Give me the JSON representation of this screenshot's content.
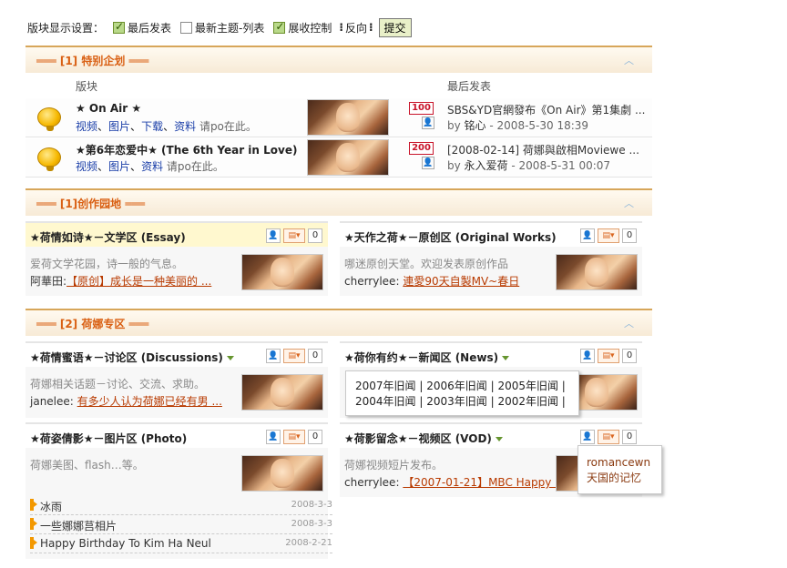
{
  "topbar": {
    "label": "版块显示设置：",
    "options": [
      {
        "label": "最后发表",
        "checked": true
      },
      {
        "label": "最新主题-列表",
        "checked": false
      },
      {
        "label": "展收控制",
        "checked": true
      }
    ],
    "reverse_label": "反向",
    "submit_label": "提交"
  },
  "section1": {
    "title": "═══ [1] 特别企划 ═══",
    "col_forum": "版块",
    "col_last": "最后发表",
    "forums": [
      {
        "title": "★ On Air ★",
        "links": [
          "视频",
          "图片",
          "下载",
          "资料"
        ],
        "post_text": "请po在此。",
        "count": "100",
        "last_title": "SBS&YD官網發布《On Air》第1集劇 ...",
        "last_by": "by",
        "last_user": "铭心",
        "last_time": "- 2008-5-30 18:39"
      },
      {
        "title": "★第6年恋爱中★ (The 6th Year in Love)",
        "links": [
          "视频",
          "图片",
          "资料"
        ],
        "post_text": "请po在此。",
        "count": "200",
        "last_title": "[2008-02-14] 荷娜與啟相Moviewe ...",
        "last_by": "by",
        "last_user": "永入爱荷",
        "last_time": "- 2008-5-31 00:07"
      }
    ]
  },
  "section2": {
    "title": "═══ [1]创作园地 ═══",
    "boxes": [
      {
        "title": "★荷情如诗★－文学区 (Essay)",
        "count": "0",
        "desc": "爱荷文学花园，诗一般的气息。",
        "last_user": "阿華田:",
        "last_post": "【原创】成长是一种美丽的 ..."
      },
      {
        "title": "★天作之荷★－原创区 (Original Works)",
        "count": "0",
        "desc": "哪迷原创天堂。欢迎发表原创作品",
        "last_user": "cherrylee:",
        "last_post": "連愛90天自製MV~春日"
      }
    ]
  },
  "section3": {
    "title": "═══ [2] 荷娜专区 ═══",
    "boxes": [
      {
        "title": "★荷情蜜语★－讨论区 (Discussions)",
        "count": "0",
        "desc": "荷娜相关话题－讨论、交流、求助。",
        "last_user": "janelee:",
        "last_post": "有多少人认为荷娜已经有男 ..."
      },
      {
        "title": "★荷你有约★－新闻区 (News)",
        "count": "0"
      },
      {
        "title": "★荷影留念★－视频区 (VOD)",
        "count": "0",
        "desc": "荷娜视频短片发布。",
        "last_user": "cherrylee:",
        "last_post": "【2007-01-21】MBC Happy ..."
      },
      {
        "title": "★荷姿倩影★－图片区 (Photo)",
        "count": "0",
        "desc": "荷娜美图、flash…等。"
      }
    ],
    "news_popup": {
      "row1": [
        "2007年旧闻",
        "2006年旧闻",
        "2005年旧闻"
      ],
      "row2": [
        "2004年旧闻",
        "2003年旧闻",
        "2002年旧闻"
      ]
    },
    "vod_popup": {
      "line1": "romancewn",
      "line2": "天国的记忆"
    },
    "photo_list": [
      {
        "title": "冰雨",
        "date": "2008-3-3"
      },
      {
        "title": "一些娜娜莒相片",
        "date": "2008-3-3"
      },
      {
        "title": "Happy Birthday To Kim Ha Neul",
        "date": "2008-2-21"
      }
    ]
  }
}
